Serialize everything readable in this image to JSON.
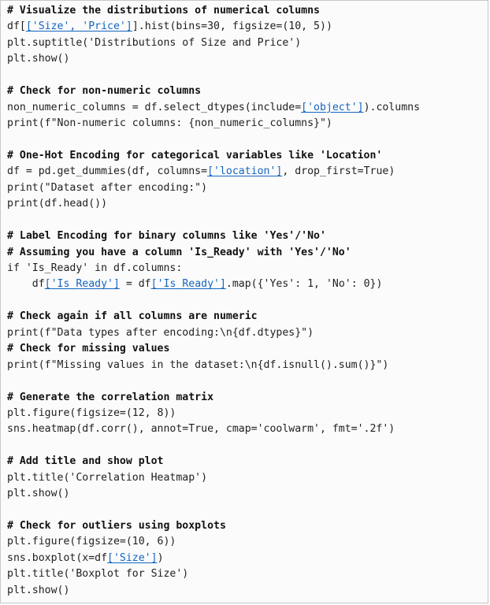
{
  "code": {
    "lines": [
      [
        {
          "t": "comment",
          "v": "# Visualize the distributions of numerical columns"
        }
      ],
      [
        {
          "t": "plain",
          "v": "df["
        },
        {
          "t": "link",
          "v": "['Size', 'Price']"
        },
        {
          "t": "plain",
          "v": "].hist(bins=30, figsize=(10, 5))"
        }
      ],
      [
        {
          "t": "plain",
          "v": "plt.suptitle('Distributions of Size and Price')"
        }
      ],
      [
        {
          "t": "plain",
          "v": "plt.show()"
        }
      ],
      [],
      [
        {
          "t": "comment",
          "v": "# Check for non-numeric columns"
        }
      ],
      [
        {
          "t": "plain",
          "v": "non_numeric_columns = df.select_dtypes(include="
        },
        {
          "t": "link",
          "v": "['object']"
        },
        {
          "t": "plain",
          "v": ").columns"
        }
      ],
      [
        {
          "t": "plain",
          "v": "print(f\"Non-numeric columns: {non_numeric_columns}\")"
        }
      ],
      [],
      [
        {
          "t": "comment",
          "v": "# One-Hot Encoding for categorical variables like 'Location'"
        }
      ],
      [
        {
          "t": "plain",
          "v": "df = pd.get_dummies(df, columns="
        },
        {
          "t": "link",
          "v": "['location']"
        },
        {
          "t": "plain",
          "v": ", drop_first=True)"
        }
      ],
      [
        {
          "t": "plain",
          "v": "print(\"Dataset after encoding:\")"
        }
      ],
      [
        {
          "t": "plain",
          "v": "print(df.head())"
        }
      ],
      [],
      [
        {
          "t": "comment",
          "v": "# Label Encoding for binary columns like 'Yes'/'No'"
        }
      ],
      [
        {
          "t": "comment",
          "v": "# Assuming you have a column 'Is_Ready' with 'Yes'/'No'"
        }
      ],
      [
        {
          "t": "plain",
          "v": "if 'Is_Ready' in df.columns:"
        }
      ],
      [
        {
          "t": "plain",
          "v": "    df"
        },
        {
          "t": "link",
          "v": "['Is_Ready']"
        },
        {
          "t": "plain",
          "v": " = df"
        },
        {
          "t": "link",
          "v": "['Is_Ready']"
        },
        {
          "t": "plain",
          "v": ".map({'Yes': 1, 'No': 0})"
        }
      ],
      [],
      [
        {
          "t": "comment",
          "v": "# Check again if all columns are numeric"
        }
      ],
      [
        {
          "t": "plain",
          "v": "print(f\"Data types after encoding:\\n{df.dtypes}\")"
        }
      ],
      [
        {
          "t": "comment",
          "v": "# Check for missing values"
        }
      ],
      [
        {
          "t": "plain",
          "v": "print(f\"Missing values in the dataset:\\n{df.isnull().sum()}\")"
        }
      ],
      [],
      [
        {
          "t": "comment",
          "v": "# Generate the correlation matrix"
        }
      ],
      [
        {
          "t": "plain",
          "v": "plt.figure(figsize=(12, 8))"
        }
      ],
      [
        {
          "t": "plain",
          "v": "sns.heatmap(df.corr(), annot=True, cmap='coolwarm', fmt='.2f')"
        }
      ],
      [],
      [
        {
          "t": "comment",
          "v": "# Add title and show plot"
        }
      ],
      [
        {
          "t": "plain",
          "v": "plt.title('Correlation Heatmap')"
        }
      ],
      [
        {
          "t": "plain",
          "v": "plt.show()"
        }
      ],
      [],
      [
        {
          "t": "comment",
          "v": "# Check for outliers using boxplots"
        }
      ],
      [
        {
          "t": "plain",
          "v": "plt.figure(figsize=(10, 6))"
        }
      ],
      [
        {
          "t": "plain",
          "v": "sns.boxplot(x=df"
        },
        {
          "t": "link",
          "v": "['Size']"
        },
        {
          "t": "plain",
          "v": ")"
        }
      ],
      [
        {
          "t": "plain",
          "v": "plt.title('Boxplot for Size')"
        }
      ],
      [
        {
          "t": "plain",
          "v": "plt.show()"
        }
      ]
    ]
  },
  "colors": {
    "link": "#1565c0",
    "background": "#fbfbfb",
    "border": "#c8c8c8"
  }
}
